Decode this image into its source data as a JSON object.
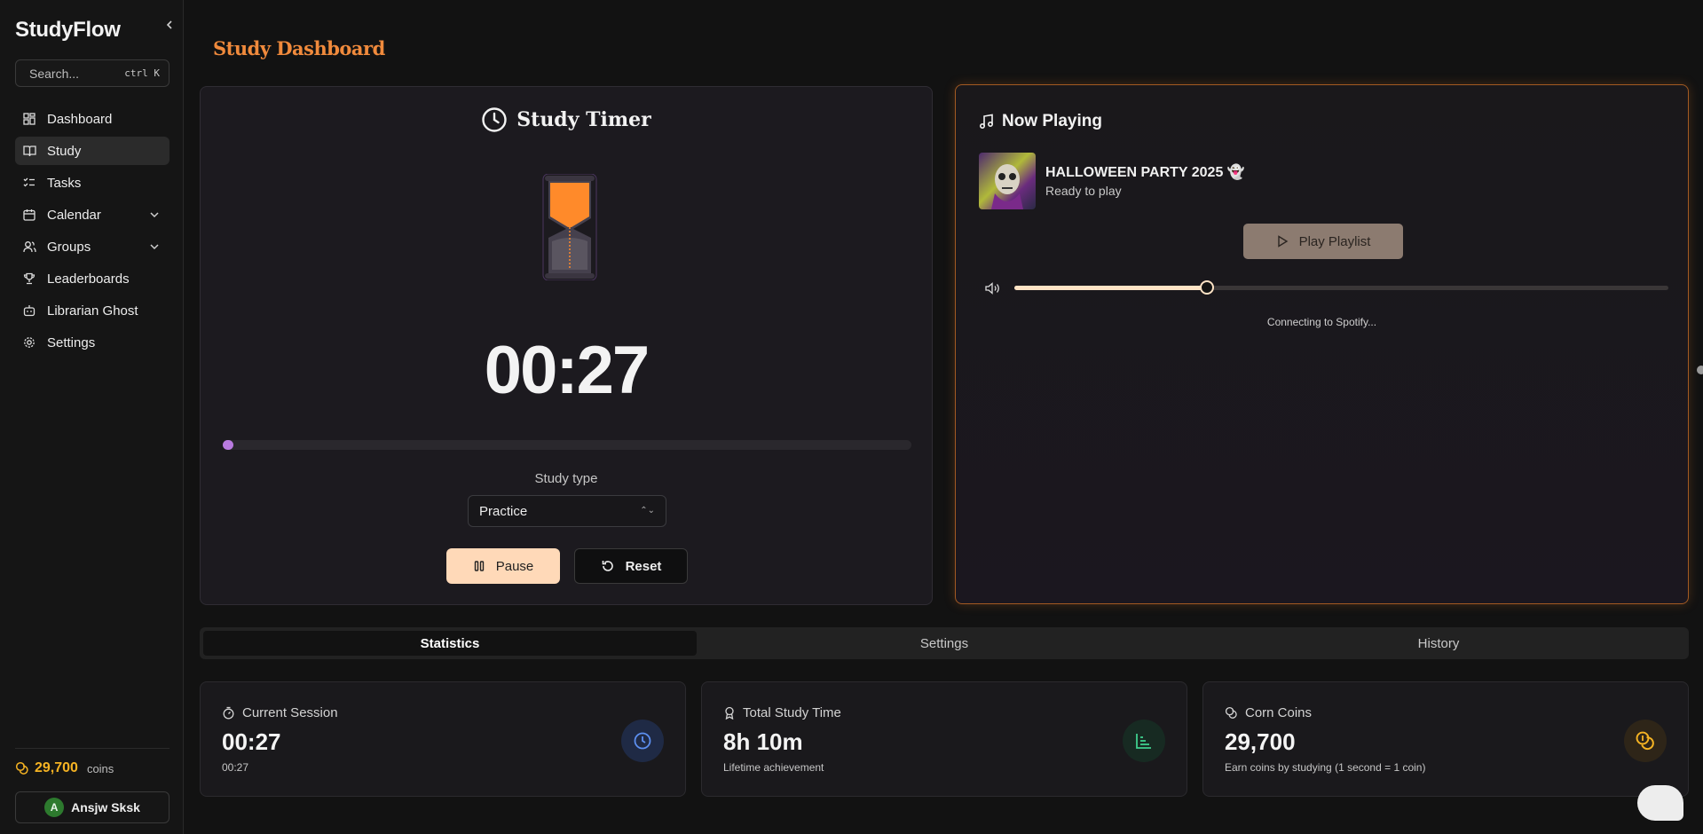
{
  "app": {
    "brand": "StudyFlow"
  },
  "sidebar": {
    "search_placeholder": "Search...",
    "search_shortcut": "ctrl K",
    "items": [
      {
        "label": "Dashboard",
        "icon": "dashboard-icon"
      },
      {
        "label": "Study",
        "icon": "book-icon",
        "active": true
      },
      {
        "label": "Tasks",
        "icon": "list-checks-icon"
      },
      {
        "label": "Calendar",
        "icon": "calendar-icon",
        "expandable": true
      },
      {
        "label": "Groups",
        "icon": "users-icon",
        "expandable": true
      },
      {
        "label": "Leaderboards",
        "icon": "trophy-icon"
      },
      {
        "label": "Librarian Ghost",
        "icon": "bot-icon"
      },
      {
        "label": "Settings",
        "icon": "gear-icon"
      }
    ],
    "coins_value": "29,700",
    "coins_unit": "coins",
    "user_initial": "A",
    "user_name": "Ansjw Sksk"
  },
  "page": {
    "title": "Study Dashboard"
  },
  "timer": {
    "title": "Study Timer",
    "time_display": "00:27",
    "progress_fraction": 0.015,
    "study_type_label": "Study type",
    "study_type_value": "Practice",
    "pause_label": "Pause",
    "reset_label": "Reset"
  },
  "player": {
    "title": "Now Playing",
    "track_name": "HALLOWEEN PARTY 2025 👻",
    "track_status": "Ready to play",
    "play_label": "Play Playlist",
    "volume_fraction": 0.295,
    "connecting_text": "Connecting to Spotify..."
  },
  "tabs": [
    {
      "label": "Statistics",
      "active": true
    },
    {
      "label": "Settings"
    },
    {
      "label": "History"
    }
  ],
  "stats": [
    {
      "title": "Current Session",
      "value": "00:27",
      "sub": "00:27",
      "icon": "timer-icon",
      "badge_icon": "clock-icon"
    },
    {
      "title": "Total Study Time",
      "value": "8h 10m",
      "sub": "Lifetime achievement",
      "icon": "award-icon",
      "badge_icon": "bar-chart-icon"
    },
    {
      "title": "Corn Coins",
      "value": "29,700",
      "sub": "Earn coins by studying (1 second = 1 coin)",
      "icon": "coins-icon",
      "badge_icon": "coins-icon"
    }
  ],
  "colors": {
    "accent_orange": "#f08a3c",
    "coins_gold": "#f5b323",
    "progress_purple": "#b97be0",
    "pause_bg": "#ffd9b8",
    "player_border": "#a35a22"
  }
}
